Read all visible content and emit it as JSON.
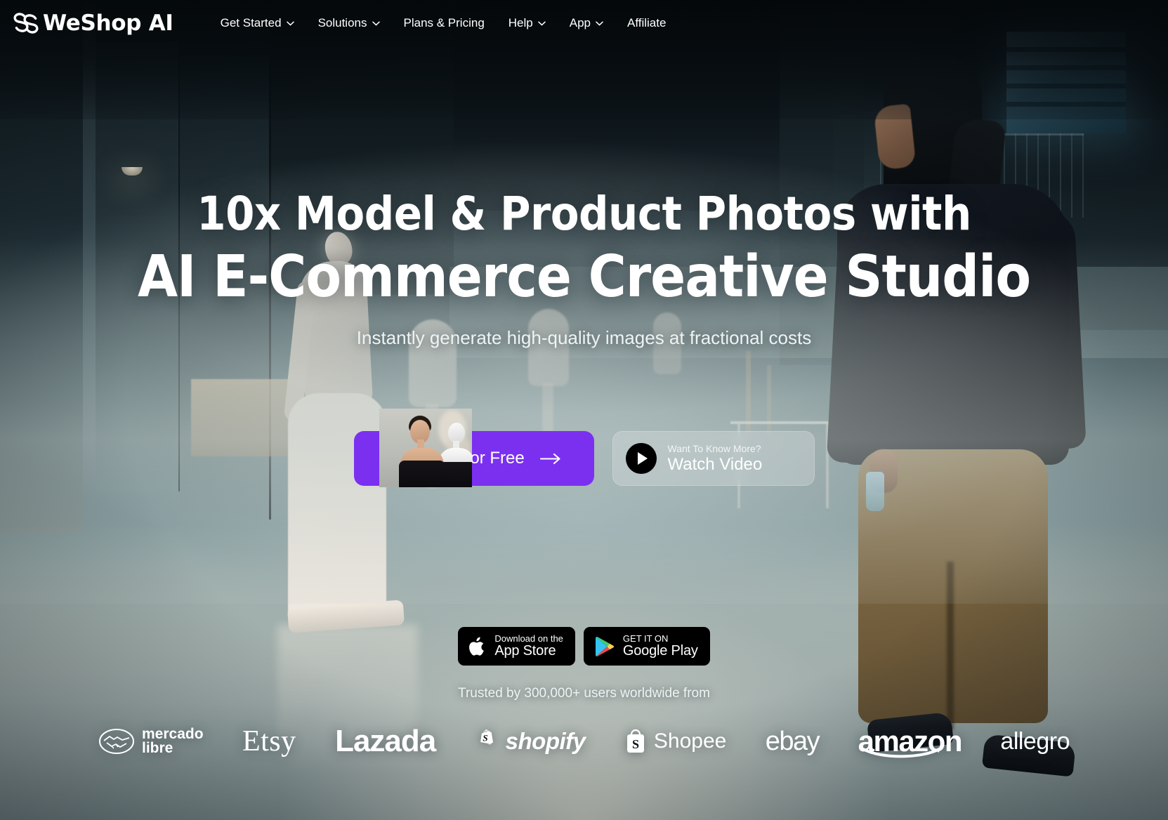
{
  "brand": {
    "name": "WeShop AI",
    "logo_icon": "weshop-interlocking-s-logo"
  },
  "nav": {
    "items": [
      {
        "label": "Get Started",
        "has_caret": true
      },
      {
        "label": "Solutions",
        "has_caret": true
      },
      {
        "label": "Plans & Pricing",
        "has_caret": false
      },
      {
        "label": "Help",
        "has_caret": true
      },
      {
        "label": "App",
        "has_caret": true
      },
      {
        "label": "Affiliate",
        "has_caret": false
      }
    ]
  },
  "hero": {
    "title_line1": "10x Model & Product Photos with",
    "title_line2": "AI E-Commerce Creative Studio",
    "subtitle": "Instantly generate high-quality images at fractional costs"
  },
  "cta": {
    "primary": {
      "label": "Try for Free",
      "icon": "arrow-right-icon",
      "color": "#7b30f0"
    },
    "secondary": {
      "eyebrow": "Want To Know More?",
      "label": "Watch Video",
      "icon": "play-icon"
    }
  },
  "stores": [
    {
      "line1": "Download on the",
      "line2": "App Store",
      "icon": "apple-icon"
    },
    {
      "line1": "GET IT ON",
      "line2": "Google Play",
      "icon": "google-play-icon"
    }
  ],
  "social_proof": {
    "text": "Trusted by 300,000+ users worldwide from",
    "logos": [
      {
        "name": "mercado libre",
        "line1": "mercado",
        "line2": "libre",
        "icon": "handshake-circle-icon"
      },
      {
        "name": "Etsy",
        "label": "Etsy"
      },
      {
        "name": "Lazada",
        "label": "Lazada"
      },
      {
        "name": "shopify",
        "label": "shopify",
        "icon": "shopify-bag-icon"
      },
      {
        "name": "Shopee",
        "label": "Shopee",
        "icon": "shopee-bag-icon"
      },
      {
        "name": "ebay",
        "label": "ebay"
      },
      {
        "name": "amazon",
        "label": "amazon",
        "icon": "amazon-swoosh-icon"
      },
      {
        "name": "allegro",
        "label": "allegro"
      }
    ]
  }
}
